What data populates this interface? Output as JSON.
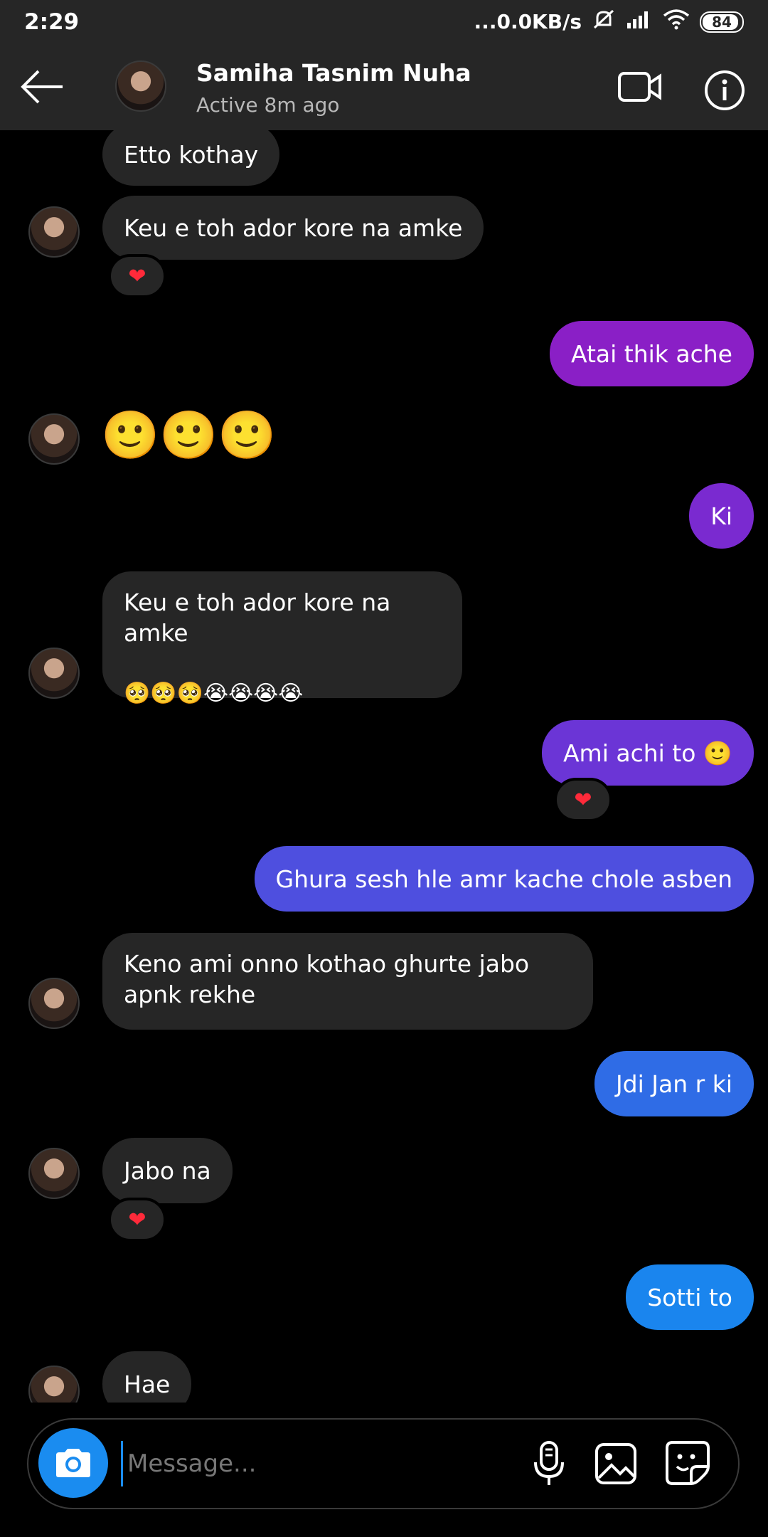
{
  "status_bar": {
    "time": "2:29",
    "network": "...0.0KB/s",
    "battery": "84"
  },
  "header": {
    "contact_name": "Samiha Tasnim Nuha",
    "contact_status": "Active 8m ago"
  },
  "messages": [
    {
      "dir": "in",
      "text": "Etto kothay"
    },
    {
      "dir": "in",
      "text": "Keu e toh ador kore na amke",
      "reaction": "❤"
    },
    {
      "dir": "out",
      "text": "Atai thik ache",
      "color": "#8a1fc6"
    },
    {
      "dir": "in",
      "text": "🙂🙂🙂"
    },
    {
      "dir": "out",
      "text": "Ki",
      "color": "#7a2ad0"
    },
    {
      "dir": "in",
      "text": "Keu e toh ador kore na amke",
      "text2": "🥺🥺🥺😭😭😭😭"
    },
    {
      "dir": "out",
      "text": "Ami achi to 🙂",
      "color": "#6b35d6",
      "reaction": "❤"
    },
    {
      "dir": "out",
      "text": "Ghura sesh hle amr kache chole asben",
      "color": "#4e4fdf"
    },
    {
      "dir": "in",
      "text": "Keno ami onno kothao ghurte jabo apnk rekhe"
    },
    {
      "dir": "out",
      "text": "Jdi Jan r ki",
      "color": "#2f6ce6"
    },
    {
      "dir": "in",
      "text": "Jabo na",
      "reaction": "❤"
    },
    {
      "dir": "out",
      "text": "Sotti to",
      "color": "#1a85ee"
    },
    {
      "dir": "in",
      "text": "Hae"
    }
  ],
  "composer": {
    "placeholder": "Message..."
  },
  "icons": [
    "back-arrow-icon",
    "video-call-icon",
    "info-icon",
    "camera-icon",
    "microphone-icon",
    "gallery-icon",
    "sticker-icon",
    "heart-icon"
  ]
}
